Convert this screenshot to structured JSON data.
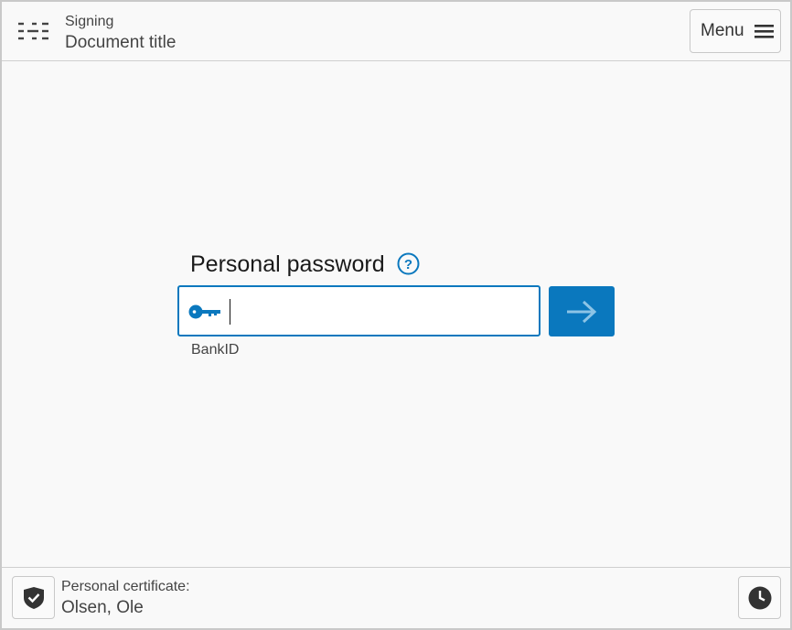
{
  "header": {
    "subtitle": "Signing",
    "title": "Document title",
    "menu_label": "Menu",
    "app_icon": "document-lines-icon",
    "menu_icon": "hamburger-icon"
  },
  "login": {
    "label": "Personal password",
    "help_icon": "question-mark-icon",
    "field_icon": "key-icon",
    "password_value": "",
    "submit_icon": "arrow-right-icon",
    "method_label": "BankID"
  },
  "footer": {
    "certificate_label": "Personal certificate:",
    "certificate_name": "Olsen, Ole",
    "shield_icon": "shield-check-icon",
    "clock_icon": "clock-icon"
  },
  "colors": {
    "accent": "#0a78be",
    "background": "#f9f9f9",
    "border": "#c8c8c8",
    "arrow": "#8cc4e6"
  }
}
